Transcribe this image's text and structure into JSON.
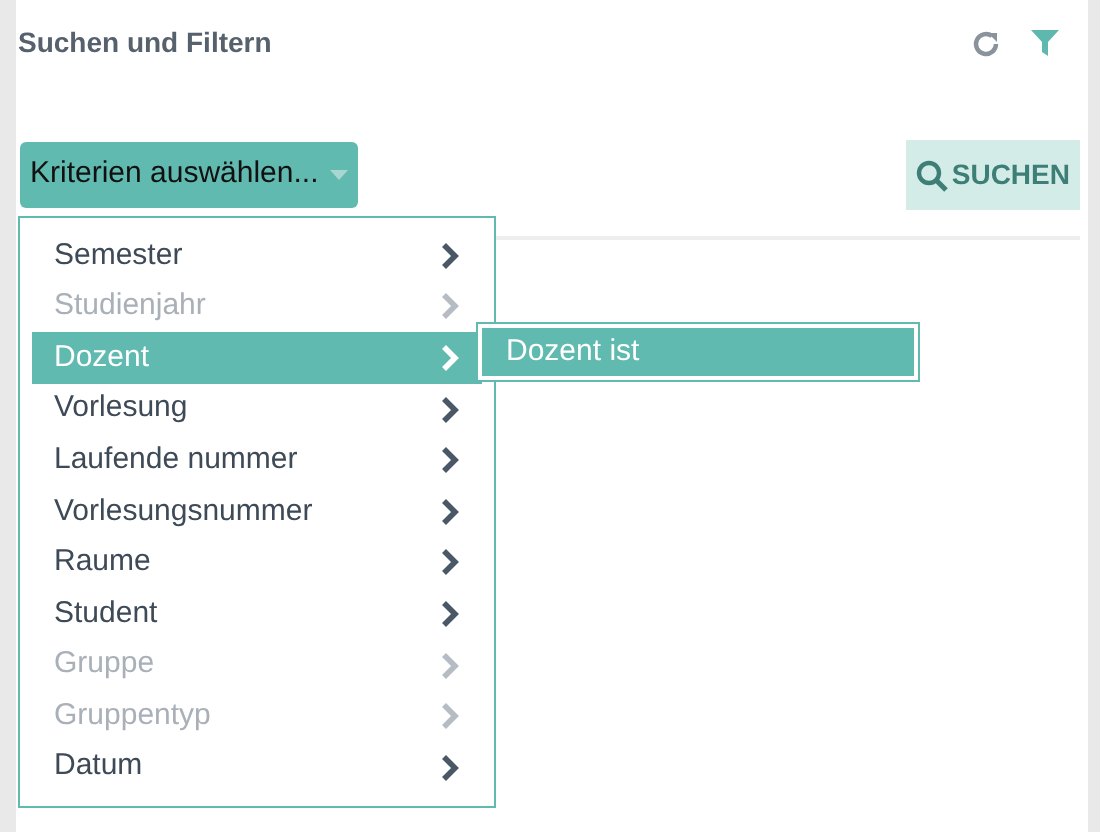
{
  "header": {
    "title": "Suchen und Filtern"
  },
  "criteria_button": {
    "label": "Kriterien auswählen..."
  },
  "search_button": {
    "label": "SUCHEN",
    "disabled": true
  },
  "menu": [
    {
      "label": "Semester",
      "disabled": false,
      "selected": false
    },
    {
      "label": "Studienjahr",
      "disabled": true,
      "selected": false
    },
    {
      "label": "Dozent",
      "disabled": false,
      "selected": true
    },
    {
      "label": "Vorlesung",
      "disabled": false,
      "selected": false
    },
    {
      "label": "Laufende nummer",
      "disabled": false,
      "selected": false
    },
    {
      "label": "Vorlesungsnummer",
      "disabled": false,
      "selected": false
    },
    {
      "label": "Raume",
      "disabled": false,
      "selected": false
    },
    {
      "label": "Student",
      "disabled": false,
      "selected": false
    },
    {
      "label": "Gruppe",
      "disabled": true,
      "selected": false
    },
    {
      "label": "Gruppentyp",
      "disabled": true,
      "selected": false
    },
    {
      "label": "Datum",
      "disabled": false,
      "selected": false
    }
  ],
  "submenu": [
    {
      "label": "Dozent ist",
      "selected": true
    }
  ]
}
